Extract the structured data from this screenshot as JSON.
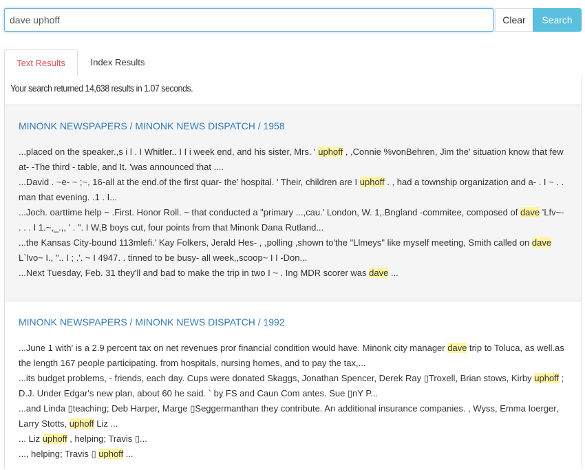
{
  "search": {
    "value": "dave uphoff",
    "clear_label": "Clear",
    "search_label": "Search"
  },
  "tabs": [
    {
      "label": "Text Results",
      "active": true
    },
    {
      "label": "Index Results",
      "active": false
    }
  ],
  "summary": "Your search returned 14,638 results in 1.07 seconds.",
  "colors": {
    "accent": "#5bc0de",
    "link": "#337ab7",
    "active_tab": "#d9534f",
    "highlight": "#fff4a3"
  },
  "results": [
    {
      "title": "MINONK NEWSPAPERS / MINONK NEWS DISPATCH / 1958",
      "snippets": [
        [
          {
            "t": "...placed on the speaker.,s i l . I Whitler.. I I i week end, and his sister, Mrs. ' "
          },
          {
            "t": "uphoff",
            "hl": true
          },
          {
            "t": " , ,Connie %vonBehren, Jim the' situation know that few at- -The third - table, and It. 'was announced that ...."
          }
        ],
        [
          {
            "t": "...David . ~e- ~ ;~, 16-all at the end.of the first quar- the' hospital. ' Their, children are I "
          },
          {
            "t": "uphoff",
            "hl": true
          },
          {
            "t": " . , had a township organization and a- . I ~ . . man that evening. .1 . I..."
          }
        ],
        [
          {
            "t": "...Joch. oarttime help ~ .First. Honor Roll. ~ that conducted a \"primary ...,cau.' London, W. 1,.Bngland -commitee, composed of "
          },
          {
            "t": "dave",
            "hl": true
          },
          {
            "t": " 'Lfv~- . . . I 1.~,_.,, ' . \". I W,B boys cut, four points from that Minonk Dana Rutland..."
          }
        ],
        [
          {
            "t": "...the Kansas City-bound 113mlefi.' Kay Folkers, Jerald Hes- , ,polling ,shown to'the \"Llmeys\" like myself meeting, Smith called on "
          },
          {
            "t": "dave",
            "hl": true
          },
          {
            "t": " L`lvo~ I., \".. I ; .'. ~ I 4947. . tinned to be busy- all week,,scoop~ I I -Don..."
          }
        ],
        [
          {
            "t": "...Next Tuesday, Feb. 31 they'll and bad to make the trip in two I ~ . Ing MDR scorer was "
          },
          {
            "t": "dave",
            "hl": true
          },
          {
            "t": " ..."
          }
        ]
      ]
    },
    {
      "title": "MINONK NEWSPAPERS / MINONK NEWS DISPATCH / 1992",
      "snippets": [
        [
          {
            "t": "...June 1 with' is a 2.9 percent tax on net revenues pror financial condition would have. Minonk city manager "
          },
          {
            "t": "dave",
            "hl": true
          },
          {
            "t": " trip to Toluca, as well.as the length 167 people participating. from hospitals, nursing homes, and to pay the tax,..."
          }
        ],
        [
          {
            "t": "...its budget problems, - friends, each day. Cups were donated Skaggs, Jonathan Spencer, Derek Ray ▯Troxell, Brian stows, Kirby "
          },
          {
            "t": "uphoff",
            "hl": true
          },
          {
            "t": " ; D.J. Under Edgar's new plan, about 60 he said. ` by FS and Caun Com antes. Sue ▯nY P..."
          }
        ],
        [
          {
            "t": "...and Linda ▯teaching; Deb Harper, Marge ▯Seggermanthan they contribute. An additional insurance companies. , Wyss, Emma Ioerger, Larry Stotts, "
          },
          {
            "t": "uphoff",
            "hl": true
          },
          {
            "t": " Liz ..."
          }
        ],
        [
          {
            "t": "... Liz "
          },
          {
            "t": "uphoff",
            "hl": true
          },
          {
            "t": " , helping; Travis ▯..."
          }
        ],
        [
          {
            "t": "..., helping; Travis ▯ "
          },
          {
            "t": "uphoff",
            "hl": true
          },
          {
            "t": " ..."
          }
        ]
      ]
    }
  ]
}
